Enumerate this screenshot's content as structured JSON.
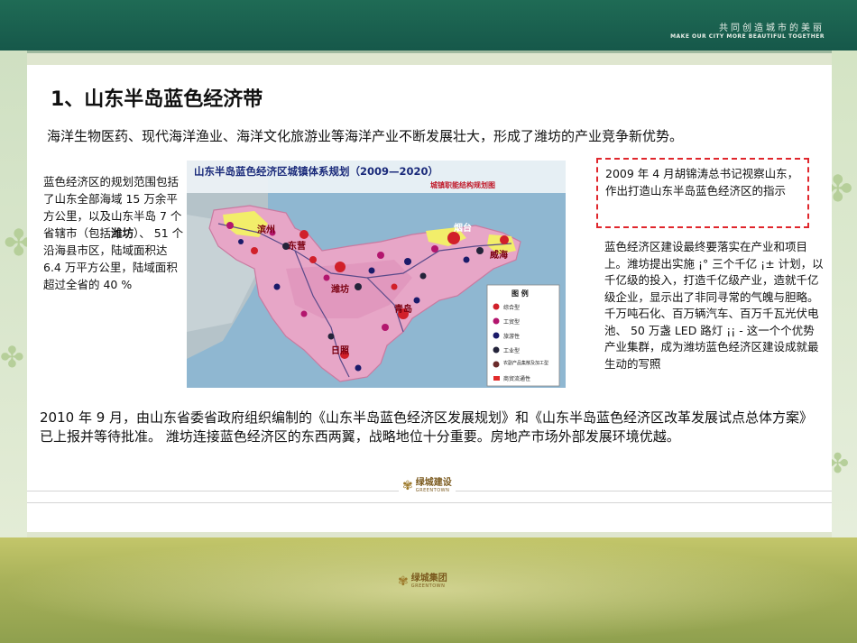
{
  "header": {
    "slogan_cn": "共同创造城市的美丽",
    "slogan_en": "MAKE OUR CITY MORE BEAUTIFUL TOGETHER"
  },
  "slide": {
    "title": "1、山东半岛蓝色经济带",
    "intro": "海洋生物医药、现代海洋渔业、海洋文化旅游业等海洋产业不断发展壮大，形成了潍坊的产业竞争新优势。",
    "left_text_a": "蓝色经济区的规划范围包括了山东全部海域 15 万余平方公里，以及山东半岛 7 个省辖市（包括",
    "left_text_bold": "潍坊",
    "left_text_b": "）、 51 个沿海县市区，陆域面积达 6.4 万平方公里，陆域面积超过全省的 40 %",
    "quote": "2009 年 4 月胡锦涛总书记视察山东，作出打造山东半岛蓝色经济区的指示",
    "right_text": "蓝色经济区建设最终要落实在产业和项目上。潍坊提出实施 ¡° 三个千亿 ¡± 计划，以千亿级的投入，打造千亿级产业，造就千亿级企业，显示出了非同寻常的气魄与胆略。千万吨石化、百万辆汽车、百万千瓦光伏电池、 50 万盏 LED 路灯 ¡¡ - 这一个个优势产业集群，成为潍坊蓝色经济区建设成就最生动的写照",
    "bottom_text": "2010 年 9 月，由山东省委省政府组织编制的《山东半岛蓝色经济区发展规划》和《山东半岛蓝色经济区改革发展试点总体方案》已上报并等待批准。 潍坊连接蓝色经济区的东西两翼，战略地位十分重要。房地产市场外部发展环境优越。"
  },
  "map": {
    "title": "山东半岛蓝色经济区城镇体系规划（2009—2020）",
    "subtitle": "城镇职能结构规划图",
    "cities": [
      "滨州",
      "东营",
      "烟台",
      "威海",
      "潍坊",
      "青岛",
      "日照"
    ],
    "legend_title": "图 例",
    "legend_items": [
      "综合型",
      "工贸型",
      "旅游性",
      "工业型",
      "农副产品集散及加工型",
      "商贸流通性"
    ],
    "legend_colors": [
      "#d1202a",
      "#b3166e",
      "#1b1b6a",
      "#24243a",
      "#6b2b2b",
      "#e22a2a"
    ]
  },
  "logos": {
    "card_cn": "绿城建设",
    "card_en": "GREENTOWN",
    "bottom_cn": "绿城集团",
    "bottom_en": "GREENTOWN"
  },
  "icons": [
    "clover-icon",
    "greentown-logo-icon"
  ]
}
